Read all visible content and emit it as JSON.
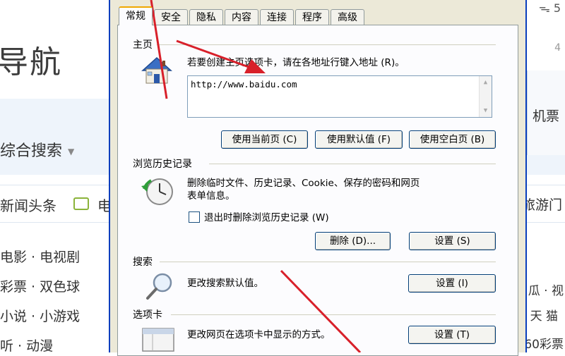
{
  "background": {
    "title": "导航",
    "search_label": "综合搜索",
    "news_label": "新闻头条",
    "news_next": "电",
    "list": [
      "电影 · 电视剧",
      "彩票 · 双色球",
      "小说 · 小游戏",
      "听 · 动漫"
    ],
    "right_top": "ᯓ 5",
    "right_small": "4",
    "right_ticket": "机票",
    "right_travel": "旅游门",
    "right_l1": "瓜 · 视",
    "right_l2": "天 猫",
    "right_l3": "60彩票"
  },
  "dialog": {
    "tabs": [
      "常规",
      "安全",
      "隐私",
      "内容",
      "连接",
      "程序",
      "高级"
    ],
    "homepage": {
      "title": "主页",
      "desc": "若要创建主页选项卡，请在各地址行键入地址 (R)。",
      "url": "http://www.baidu.com",
      "buttons": [
        "使用当前页 (C)",
        "使用默认值 (F)",
        "使用空白页 (B)"
      ]
    },
    "history": {
      "title": "浏览历史记录",
      "desc_line1": "删除临时文件、历史记录、Cookie、保存的密码和网页",
      "desc_line2": "表单信息。",
      "checkbox_label": "退出时删除浏览历史记录 (W)",
      "delete_button": "删除 (D)...",
      "settings_button": "设置 (S)"
    },
    "search": {
      "title": "搜索",
      "desc": "更改搜索默认值。",
      "settings_button": "设置 (I)"
    },
    "tabs_group": {
      "title": "选项卡",
      "desc": "更改网页在选项卡中显示的方式。",
      "settings_button": "设置 (T)"
    }
  },
  "colors": {
    "dialog_bg": "#ece9d8",
    "panel_bg": "#fcfcfe",
    "frame_blue": "#0a3fbd",
    "arrow_red": "#d8202a"
  }
}
